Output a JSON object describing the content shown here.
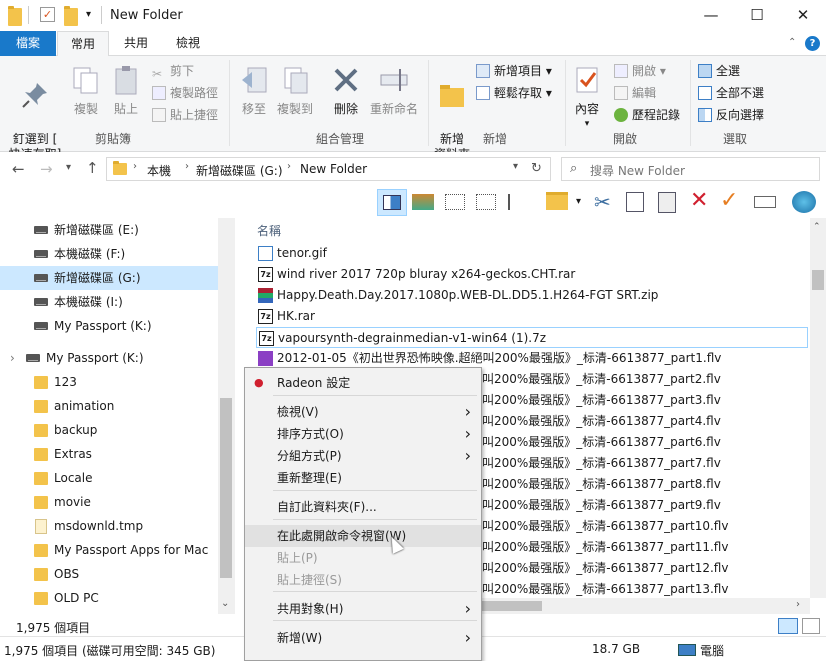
{
  "window": {
    "title": "New Folder",
    "min": "—",
    "max": "☐",
    "close": "✕"
  },
  "tabs": {
    "file": "檔案",
    "home": "常用",
    "share": "共用",
    "view": "檢視"
  },
  "ribbon": {
    "pin": "釘選到 [\n快速存取]",
    "copy": "複製",
    "paste": "貼上",
    "cut": "剪下",
    "copy_path": "複製路徑",
    "paste_shortcut": "貼上捷徑",
    "group_clipboard": "剪貼簿",
    "move_to": "移至",
    "copy_to": "複製到",
    "delete": "刪除",
    "rename": "重新命名",
    "group_organize": "組合管理",
    "new_folder": "新增\n資料夾",
    "new_item": "新增項目 ▾",
    "easy_access": "輕鬆存取 ▾",
    "group_new": "新增",
    "properties": "內容",
    "open": "開啟 ▾",
    "edit": "編輯",
    "history": "歷程記錄",
    "group_open": "開啟",
    "select_all": "全選",
    "select_none": "全部不選",
    "invert": "反向選擇",
    "group_select": "選取"
  },
  "address": {
    "path": [
      "本機",
      "新增磁碟區 (G:)",
      "New Folder"
    ],
    "search_placeholder": "搜尋 New Folder"
  },
  "nav": {
    "items": [
      {
        "label": "新增磁碟區 (E:)",
        "type": "drive"
      },
      {
        "label": "本機磁碟 (F:)",
        "type": "drive"
      },
      {
        "label": "新增磁碟區 (G:)",
        "type": "drive",
        "selected": true
      },
      {
        "label": "本機磁碟 (I:)",
        "type": "drive"
      },
      {
        "label": "My Passport (K:)",
        "type": "drive"
      },
      {
        "label": "My Passport (K:)",
        "type": "drive-root"
      },
      {
        "label": "123",
        "type": "folder"
      },
      {
        "label": "animation",
        "type": "folder"
      },
      {
        "label": "backup",
        "type": "folder"
      },
      {
        "label": "Extras",
        "type": "folder"
      },
      {
        "label": "Locale",
        "type": "folder"
      },
      {
        "label": "movie",
        "type": "folder"
      },
      {
        "label": "msdownld.tmp",
        "type": "file"
      },
      {
        "label": "My Passport Apps for Mac",
        "type": "folder"
      },
      {
        "label": "OBS",
        "type": "folder"
      },
      {
        "label": "OLD PC",
        "type": "folder"
      }
    ]
  },
  "list": {
    "column_name": "名稱",
    "files": [
      {
        "name": "tenor.gif",
        "icon": "gif-icon"
      },
      {
        "name": "wind river 2017 720p bluray x264-geckos.CHT.rar",
        "icon": "7z-icon"
      },
      {
        "name": "Happy.Death.Day.2017.1080p.WEB-DL.DD5.1.H264-FGT SRT.zip",
        "icon": "winrar-icon"
      },
      {
        "name": "HK.rar",
        "icon": "7z-icon"
      },
      {
        "name": "vapoursynth-degrainmedian-v1-win64 (1).7z",
        "icon": "7z-icon",
        "selected": true
      },
      {
        "name": "2012-01-05《初出世界恐怖映像.超絕叫200%最强版》_标清-6613877_part1.flv",
        "icon": "flv-icon"
      },
      {
        "name": "叫200%最强版》_标清-6613877_part2.flv",
        "icon": "none"
      },
      {
        "name": "叫200%最强版》_标清-6613877_part3.flv",
        "icon": "none"
      },
      {
        "name": "叫200%最强版》_标清-6613877_part4.flv",
        "icon": "none"
      },
      {
        "name": "叫200%最强版》_标清-6613877_part6.flv",
        "icon": "none"
      },
      {
        "name": "叫200%最强版》_标清-6613877_part7.flv",
        "icon": "none"
      },
      {
        "name": "叫200%最强版》_标清-6613877_part8.flv",
        "icon": "none"
      },
      {
        "name": "叫200%最强版》_标清-6613877_part9.flv",
        "icon": "none"
      },
      {
        "name": "叫200%最强版》_标清-6613877_part10.flv",
        "icon": "none"
      },
      {
        "name": "叫200%最强版》_标清-6613877_part11.flv",
        "icon": "none"
      },
      {
        "name": "叫200%最强版》_标清-6613877_part12.flv",
        "icon": "none"
      },
      {
        "name": "叫200%最强版》_标清-6613877_part13.flv",
        "icon": "none"
      }
    ]
  },
  "context_menu": {
    "items": [
      {
        "label": "Radeon 設定"
      },
      {
        "label": "檢視(V)",
        "sub": true
      },
      {
        "label": "排序方式(O)",
        "sub": true
      },
      {
        "label": "分組方式(P)",
        "sub": true
      },
      {
        "label": "重新整理(E)"
      },
      {
        "label": "自訂此資料夾(F)..."
      },
      {
        "label": "在此處開啟命令視窗(W)",
        "highlight": true
      },
      {
        "label": "貼上(P)",
        "disabled": true
      },
      {
        "label": "貼上捷徑(S)",
        "disabled": true
      },
      {
        "label": "共用對象(H)",
        "sub": true
      },
      {
        "label": "新增(W)",
        "sub": true
      }
    ]
  },
  "status": {
    "count_top": "1,975 個項目",
    "count_bottom": "1,975 個項目 (磁碟可用空間: 345 GB)",
    "size": "18.7 GB",
    "computer": "電腦"
  },
  "colors": {
    "accent": "#1979ca",
    "selection": "#cce8ff",
    "menu_bg": "#f2f2f2"
  }
}
